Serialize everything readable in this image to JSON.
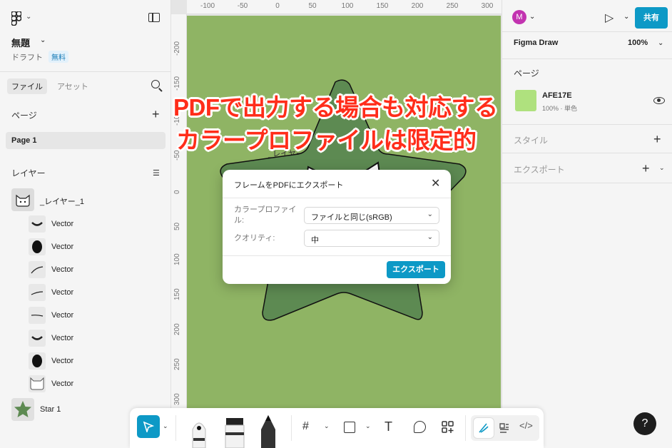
{
  "left_panel": {
    "file_name": "無題",
    "draft_label": "ドラフト",
    "plan_badge": "無料",
    "tabs": [
      "ファイル",
      "アセット"
    ],
    "pages_heading": "ページ",
    "pages": [
      "Page 1"
    ],
    "layers_heading": "レイヤー",
    "frame_name": "_レイヤー_1",
    "layers": [
      "Vector",
      "Vector",
      "Vector",
      "Vector",
      "Vector",
      "Vector",
      "Vector",
      "Vector"
    ],
    "star_name": "Star 1"
  },
  "canvas": {
    "ruler_x": [
      "-100",
      "-50",
      "0",
      "50",
      "100",
      "150",
      "200",
      "250",
      "300"
    ],
    "ruler_y": [
      "-200",
      "-150",
      "-100",
      "-50",
      "0",
      "50",
      "100",
      "150",
      "200",
      "250",
      "300"
    ],
    "frame_label": "_レイヤー_1",
    "frame_color": "#8fb464"
  },
  "overlay": {
    "line1": "PDFで出力する場合も対応する",
    "line2": "カラープロファイルは限定的",
    "color": "#ff2d1a"
  },
  "dialog": {
    "title": "フレームをPDFにエクスポート",
    "close": "✕",
    "color_profile_label": "カラープロファイル:",
    "color_profile_value": "ファイルと同じ(sRGB)",
    "quality_label": "クオリティ:",
    "quality_value": "中",
    "export_button": "エクスポート"
  },
  "right_panel": {
    "avatar": "M",
    "share_button": "共有",
    "mode": "Figma Draw",
    "zoom": "100%",
    "page_heading": "ページ",
    "fill_hex": "AFE17E",
    "fill_sub": "100% · 単色",
    "styles_heading": "スタイル",
    "export_heading": "エクスポート",
    "help": "?",
    "accent": "#0d99c6"
  },
  "toolbar": {
    "icons": [
      "move-tool",
      "pen-tool",
      "marker-tool",
      "pencil-tool",
      "frame-tool",
      "shape-tool",
      "text-tool",
      "comment-tool",
      "actions-tool",
      "draw-mode",
      "design-mode",
      "dev-mode"
    ]
  }
}
